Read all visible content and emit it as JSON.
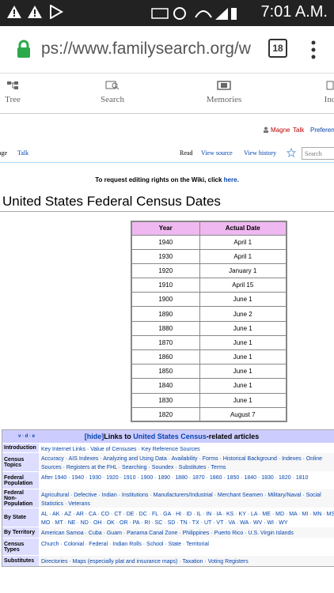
{
  "status": {
    "time": "7:01 A.M."
  },
  "browser": {
    "url": "ps://www.familysearch.org/w",
    "tabs_count": "18"
  },
  "nav": {
    "items": [
      {
        "label": "Tree",
        "icon": "tree-icon"
      },
      {
        "label": "Search",
        "icon": "search-icon"
      },
      {
        "label": "Memories",
        "icon": "memories-icon"
      },
      {
        "label": "Ind",
        "icon": "indexing-icon"
      }
    ]
  },
  "user": {
    "name": "Magne",
    "talk": "Talk",
    "prefs": "Preferen"
  },
  "tabs": {
    "page": "age",
    "talk": "Talk",
    "read": "Read",
    "view_source": "View source",
    "view_history": "View history",
    "search_placeholder": "Search"
  },
  "notice": {
    "text": "To request editing rights on the Wiki, click ",
    "link": "here."
  },
  "page_title": "United States Federal Census Dates",
  "census_table": {
    "headers": [
      "Year",
      "Actual Date"
    ],
    "rows": [
      [
        "1940",
        "April 1"
      ],
      [
        "1930",
        "April 1"
      ],
      [
        "1920",
        "January 1"
      ],
      [
        "1910",
        "April 15"
      ],
      [
        "1900",
        "June 1"
      ],
      [
        "1890",
        "June 2"
      ],
      [
        "1880",
        "June 1"
      ],
      [
        "1870",
        "June 1"
      ],
      [
        "1860",
        "June 1"
      ],
      [
        "1850",
        "June 1"
      ],
      [
        "1840",
        "June 1"
      ],
      [
        "1830",
        "June 1"
      ],
      [
        "1820",
        "August 7"
      ]
    ]
  },
  "navbox": {
    "vde": "v · d · e",
    "hide": "[hide]",
    "title_pre": "Links to ",
    "title_link": "United States Census",
    "title_post": "-related articles",
    "rows": [
      {
        "group": "Introduction",
        "list": "Key Internet Links · Value of Censuses · Key Reference Sources"
      },
      {
        "group": "Census Topics",
        "list": "Accuracy · AIS Indexes · Analyzing and Using Data · Availability · Forms · Historical Background · Indexes · Online Sources · Registers at the FHL · Searching · Soundex · Substitutes · Terms"
      },
      {
        "group": "Federal Population",
        "list": "After 1940 · 1940 · 1930 · 1920 · 1910 · 1900 · 1890 · 1880 · 1870 · 1860 · 1850 · 1840 · 1830 · 1820 · 1810"
      },
      {
        "group": "Federal Non-Population",
        "list": "Agricultural · Defective · Indian · Institutions · Manufacturers/Industrial · Merchant Seamen · Military/Naval · Social Statistics · Veterans"
      },
      {
        "group": "By State",
        "list": "AL · AK · AZ · AR · CA · CO · CT · DE · DC · FL · GA · HI · ID · IL · IN · IA · KS · KY · LA · ME · MD · MA · MI · MN · MS · MO · MT · NE · ND · OH · OK · OR · PA · RI · SC · SD · TN · TX · UT · VT · VA · WA · WV · WI · WY"
      },
      {
        "group": "By Territory",
        "list": "American Samoa · Cuba · Guam · Panama Canal Zone · Philippines · Puerto Rico · U.S. Virgin Islands"
      },
      {
        "group": "Census Types",
        "list": "Church · Colonial · Federal · Indian Rolls · School · State · Territorial"
      },
      {
        "group": "Substitutes",
        "list": "Directories · Maps (especially plat and insurance maps) · Taxation · Voting Registers"
      }
    ]
  }
}
